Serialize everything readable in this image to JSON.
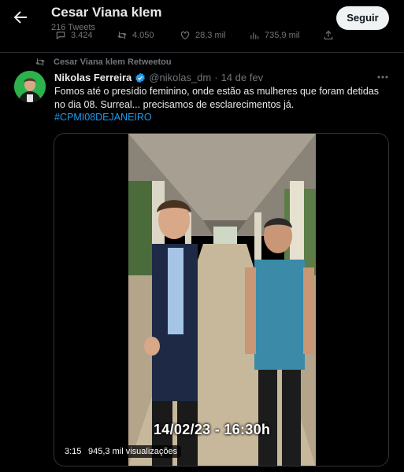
{
  "header": {
    "title": "Cesar Viana klem",
    "subtitle": "216 Tweets",
    "follow_label": "Seguir"
  },
  "prev_tweet_actions": {
    "replies": "3.424",
    "retweets": "4.050",
    "likes": "28,3 mil",
    "views": "735,9 mil"
  },
  "retweet_context": {
    "label": "Cesar Viana klem Retweetou"
  },
  "tweet": {
    "author_name": "Nikolas Ferreira",
    "handle": "@nikolas_dm",
    "separator": "·",
    "date": "14 de fev",
    "text": "Fomos até o presídio feminino, onde estão as mulheres que foram detidas no dia 08. Surreal... precisamos de esclarecimentos já.",
    "hashtag": "#CPMI08DEJANEIRO"
  },
  "media": {
    "overlay_text": "14/02/23 - 16:30h",
    "duration": "3:15",
    "view_count": "945,3 mil visualizações"
  },
  "colors": {
    "background": "#000000",
    "text_primary": "#e7e9ea",
    "text_secondary": "#71767b",
    "link": "#1d9bf0",
    "verified": "#1d9bf0",
    "border": "#2f3336",
    "button_bg": "#eff3f4"
  },
  "icons": {
    "back": "arrow-left-icon",
    "reply": "reply-icon",
    "retweet": "retweet-icon",
    "like": "heart-icon",
    "views": "views-icon",
    "share": "share-icon",
    "verified": "verified-badge-icon",
    "more": "more-icon"
  }
}
